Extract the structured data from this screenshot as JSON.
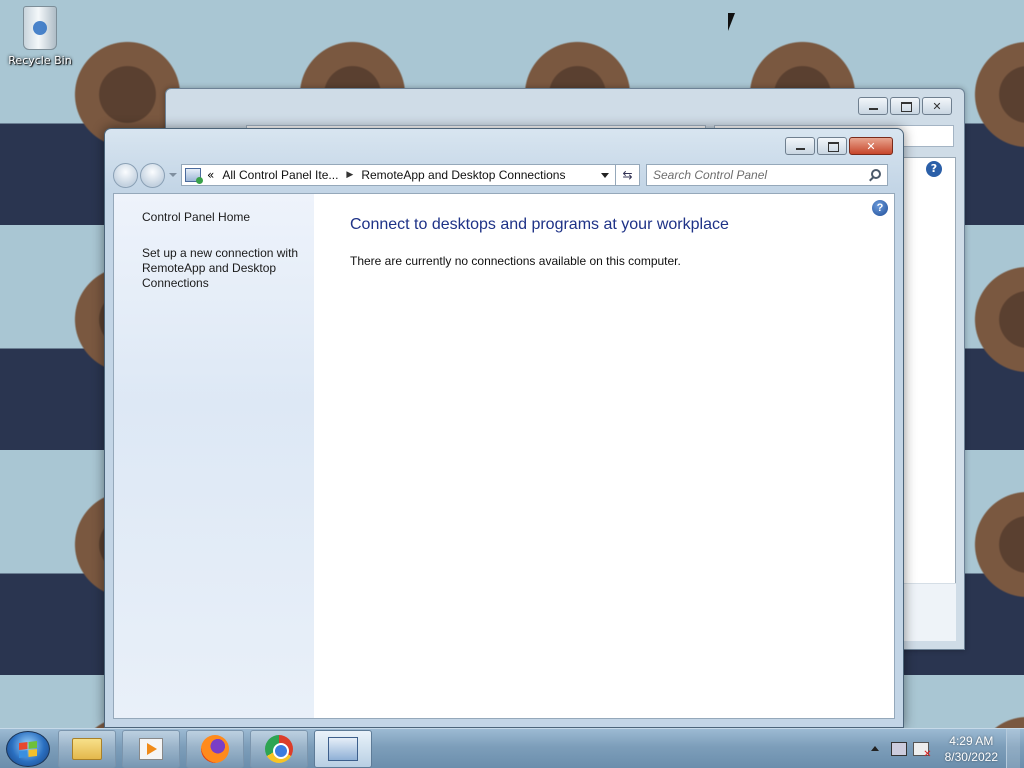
{
  "desktop": {
    "recycle_bin_label": "Recycle Bin"
  },
  "window": {
    "breadcrumb": {
      "overflow": "«",
      "parent": "All Control Panel Ite...",
      "current": "RemoteApp and Desktop Connections"
    },
    "search_placeholder": "Search Control Panel",
    "sidebar": {
      "items": [
        {
          "label": "Control Panel Home"
        },
        {
          "label": "Set up a new connection with RemoteApp and Desktop Connections"
        }
      ]
    },
    "main": {
      "heading": "Connect to desktops and programs at your workplace",
      "message": "There are currently no connections available on this computer."
    },
    "help_glyph": "?"
  },
  "taskbar": {
    "clock": {
      "time": "4:29 AM",
      "date": "8/30/2022"
    },
    "pinned": [
      "windows-explorer",
      "media-player",
      "firefox",
      "chrome",
      "control-panel"
    ]
  },
  "colors": {
    "heading": "#1e3287",
    "close_button": "#c7462b",
    "taskbar": "#7d9eba"
  }
}
